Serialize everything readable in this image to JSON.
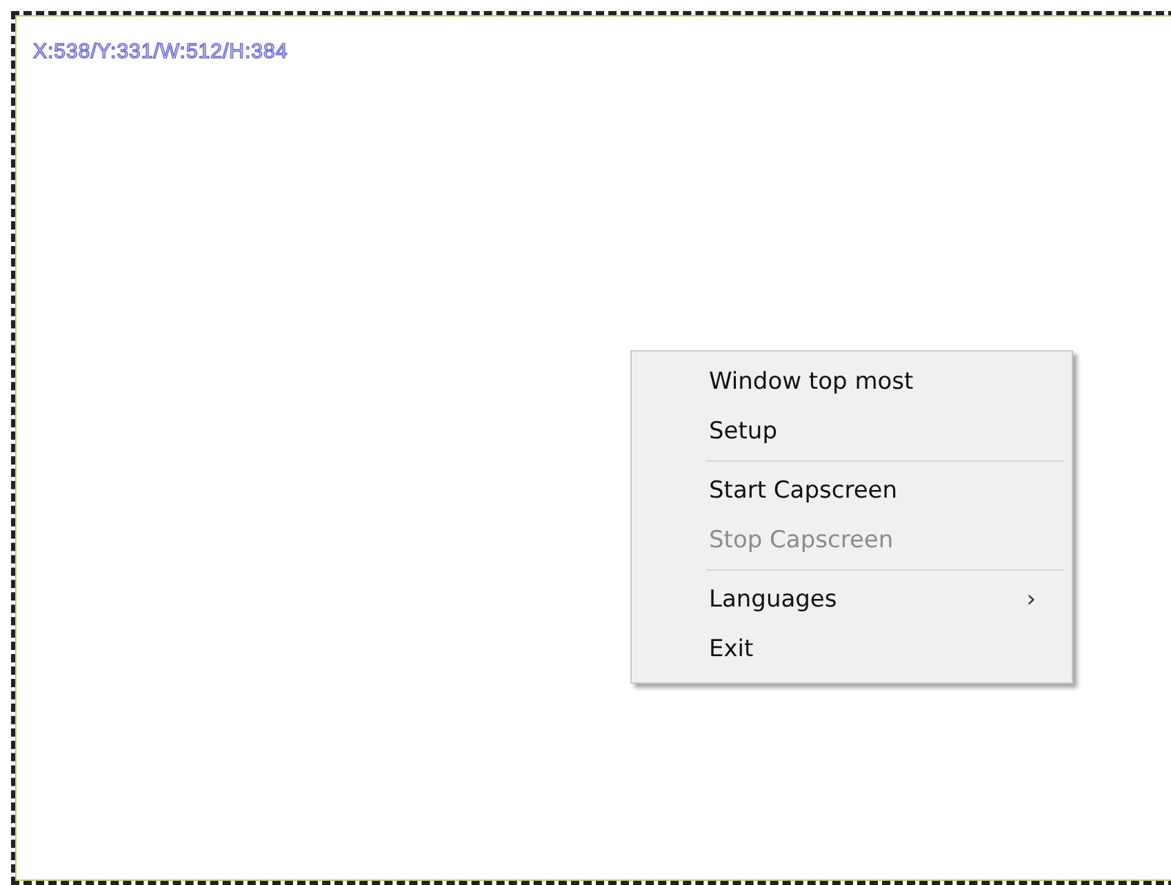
{
  "capture_frame": {
    "coordinates": "X:538/Y:331/W:512/H:384"
  },
  "context_menu": {
    "items": [
      {
        "kind": "item",
        "label": "Window top most",
        "disabled": false
      },
      {
        "kind": "item",
        "label": "Setup",
        "disabled": false
      },
      {
        "kind": "separator"
      },
      {
        "kind": "item",
        "label": "Start Capscreen",
        "disabled": false
      },
      {
        "kind": "item",
        "label": "Stop Capscreen",
        "disabled": true
      },
      {
        "kind": "separator"
      },
      {
        "kind": "item",
        "label": "Languages",
        "disabled": false,
        "submenu_arrow": "›"
      },
      {
        "kind": "item",
        "label": "Exit",
        "disabled": false
      }
    ]
  }
}
